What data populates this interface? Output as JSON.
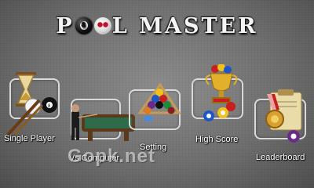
{
  "game": {
    "title_prefix": "P",
    "title_suffix": "L MASTER"
  },
  "menu": {
    "single_player": "Single Player",
    "vs_computer": "Vs.Computer",
    "setting": "Setting",
    "high_score": "High Score",
    "leaderboard": "Leaderboard"
  },
  "watermark": "Gopk.net",
  "colors": {
    "box_border": "#d9d9d9",
    "accent_red": "#c1122b",
    "table_felt": "#2f6b4a"
  }
}
